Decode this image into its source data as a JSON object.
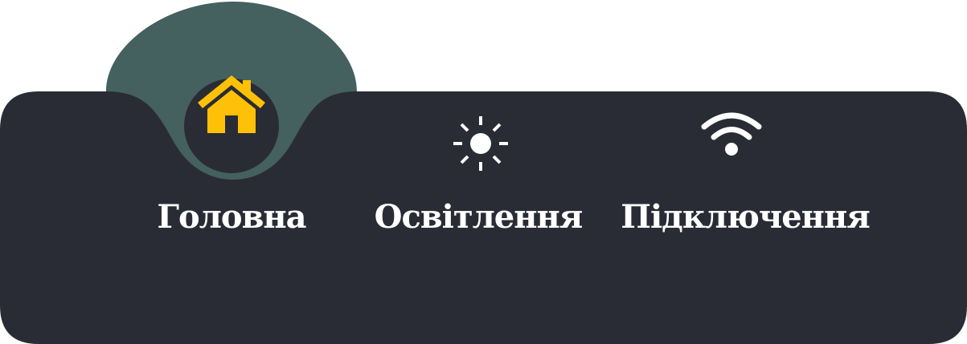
{
  "colors": {
    "bar_background": "#2a2c35",
    "active_tab_bubble": "#44605f",
    "active_icon": "#ffc107",
    "label_text": "#ffffff",
    "inactive_icon": "#ffffff"
  },
  "tabs": [
    {
      "id": "home",
      "label": "Головна",
      "icon": "house-icon",
      "active": true
    },
    {
      "id": "lighting",
      "label": "Освітлення",
      "icon": "sun-icon",
      "active": false
    },
    {
      "id": "connection",
      "label": "Підключення",
      "icon": "wifi-icon",
      "active": false
    }
  ]
}
